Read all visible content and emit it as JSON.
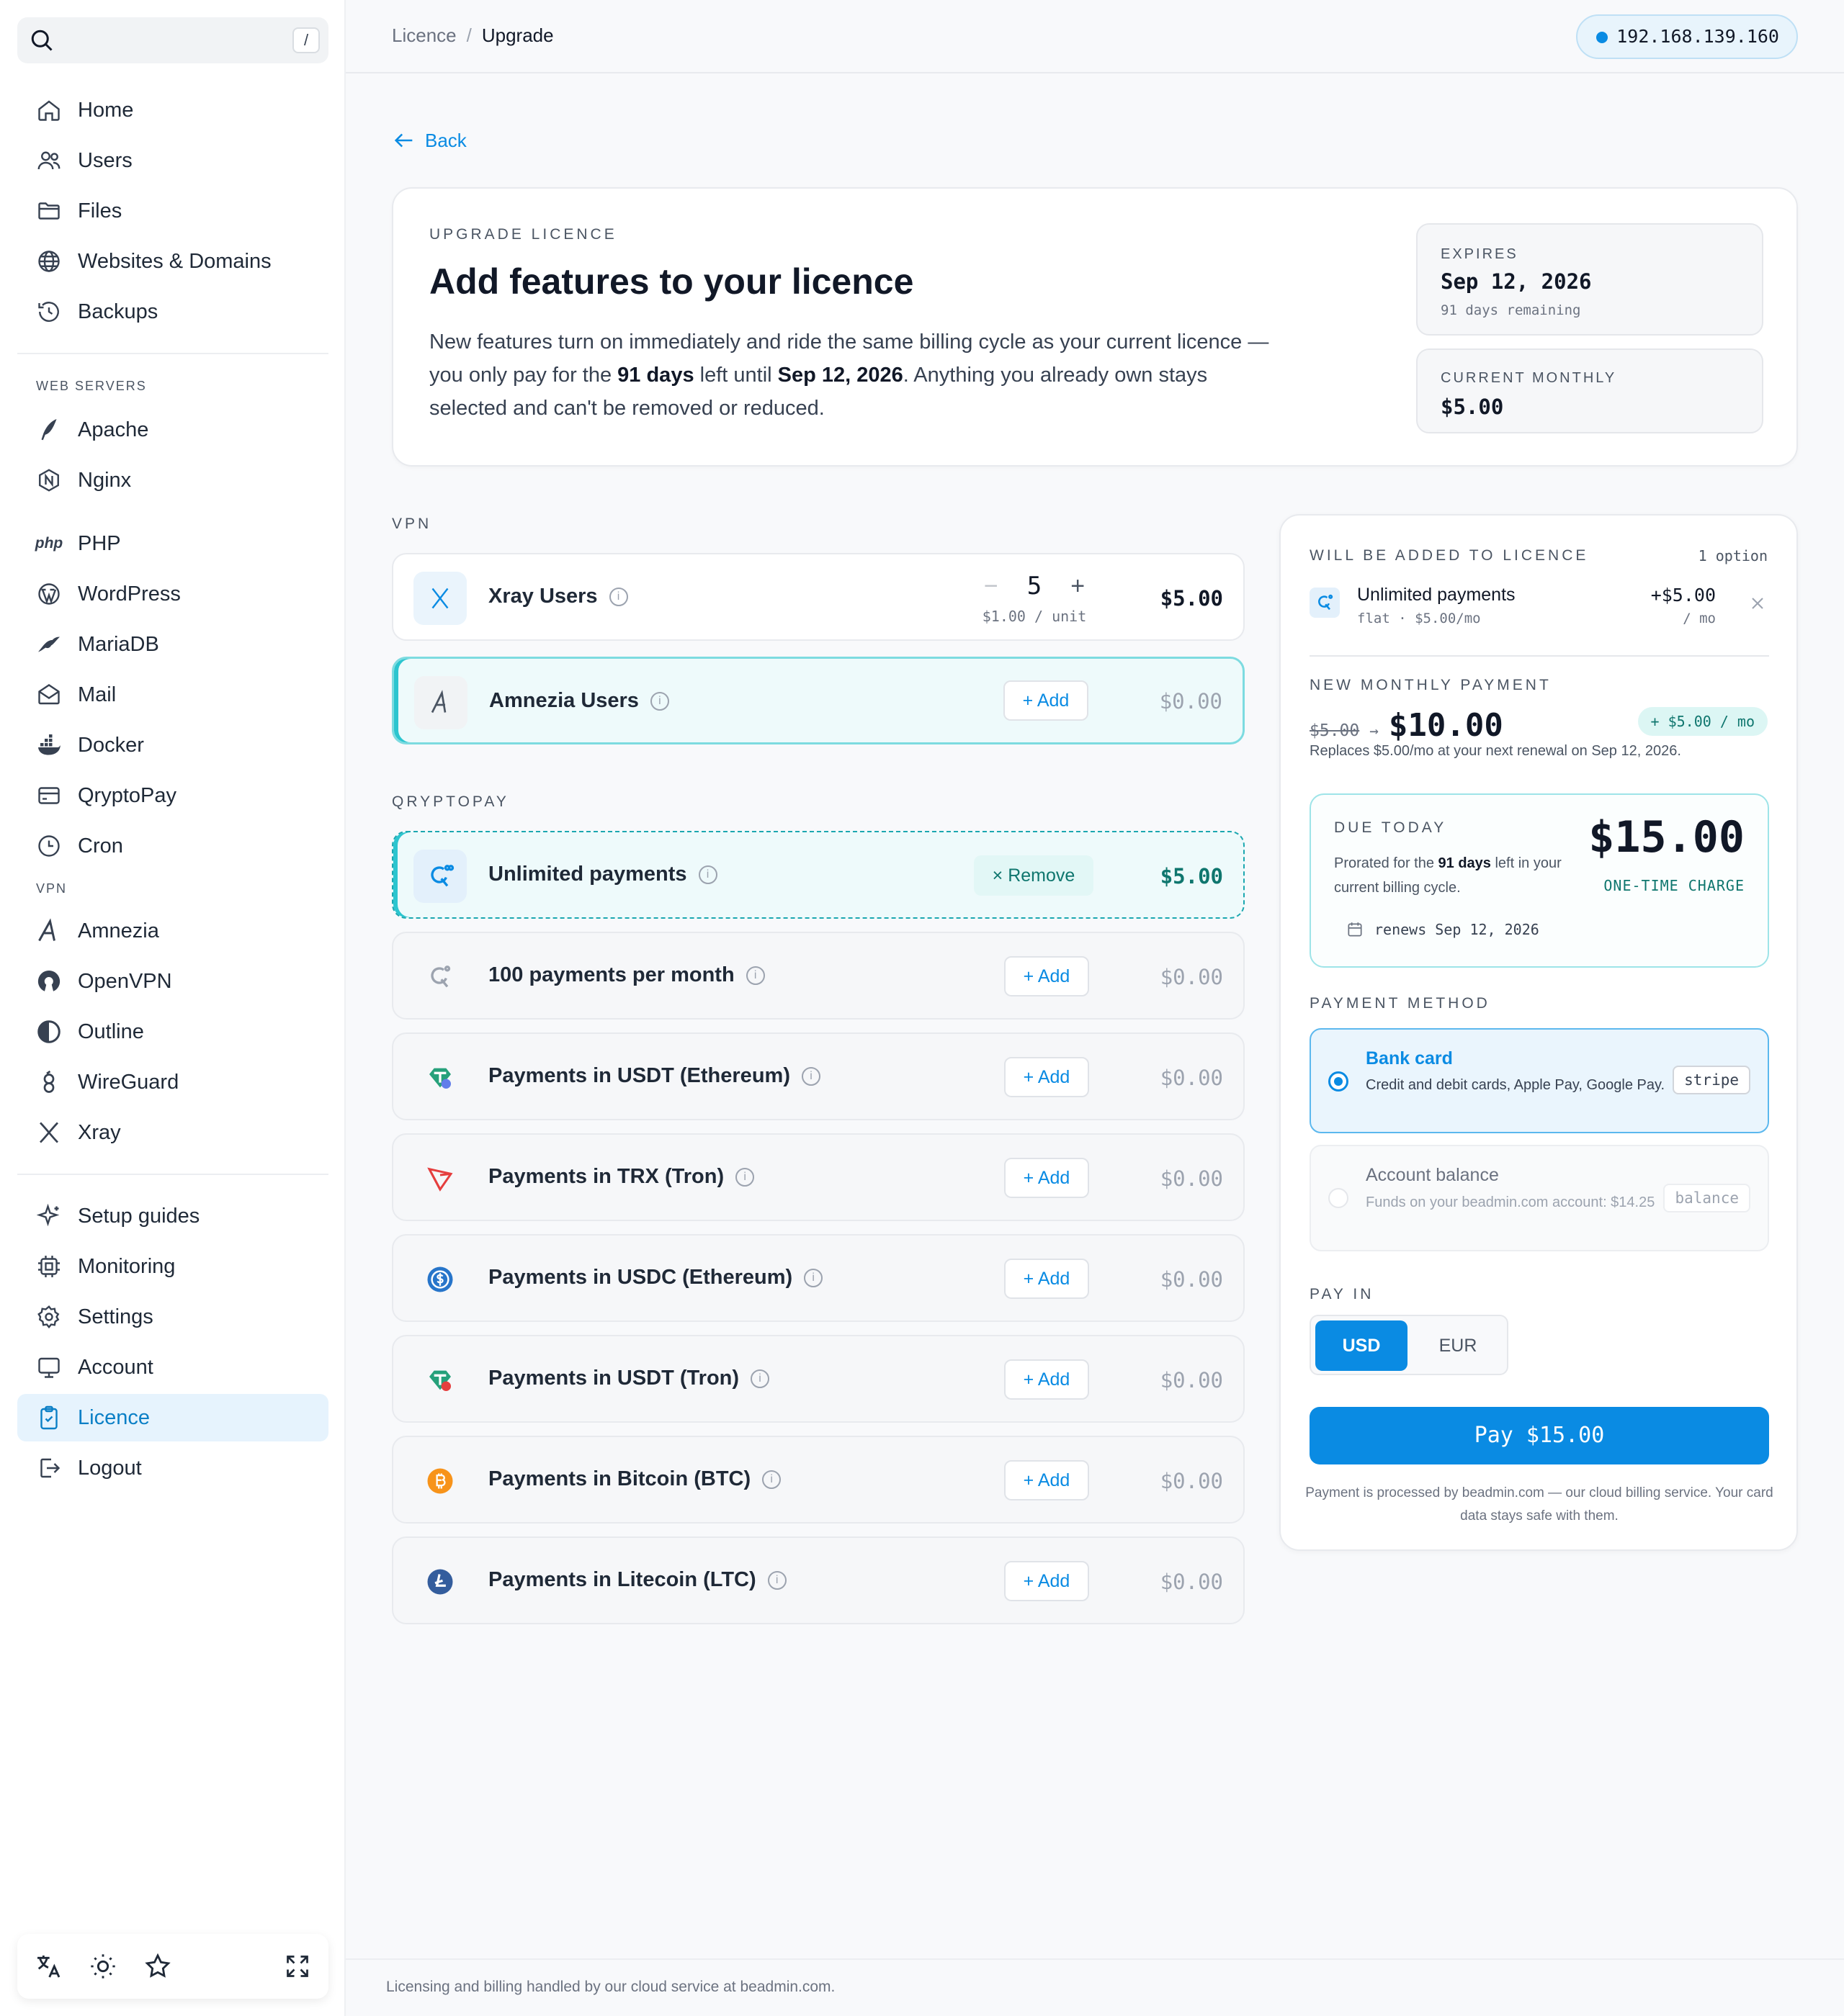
{
  "sidebar": {
    "search_shortcut": "/",
    "items_top": [
      {
        "label": "Home",
        "icon": "home-icon"
      },
      {
        "label": "Users",
        "icon": "users-icon"
      },
      {
        "label": "Files",
        "icon": "folder-icon"
      },
      {
        "label": "Websites & Domains",
        "icon": "globe-icon"
      },
      {
        "label": "Backups",
        "icon": "history-icon"
      }
    ],
    "group_web": "WEB SERVERS",
    "items_web": [
      {
        "label": "Apache",
        "icon": "feather-icon"
      },
      {
        "label": "Nginx",
        "icon": "nginx-icon"
      }
    ],
    "items_apps": [
      {
        "label": "PHP",
        "icon": "php-icon",
        "glyph": "php"
      },
      {
        "label": "WordPress",
        "icon": "wordpress-icon"
      },
      {
        "label": "MariaDB",
        "icon": "mariadb-icon"
      },
      {
        "label": "Mail",
        "icon": "mail-icon"
      },
      {
        "label": "Docker",
        "icon": "docker-icon"
      },
      {
        "label": "QryptoPay",
        "icon": "card-icon"
      },
      {
        "label": "Cron",
        "icon": "clock-icon"
      }
    ],
    "group_vpn": "VPN",
    "items_vpn": [
      {
        "label": "Amnezia",
        "icon": "amnezia-icon"
      },
      {
        "label": "OpenVPN",
        "icon": "openvpn-icon"
      },
      {
        "label": "Outline",
        "icon": "outline-icon"
      },
      {
        "label": "WireGuard",
        "icon": "wireguard-icon"
      },
      {
        "label": "Xray",
        "icon": "xray-icon"
      }
    ],
    "items_bottom": [
      {
        "label": "Setup guides",
        "icon": "sparkles-icon"
      },
      {
        "label": "Monitoring",
        "icon": "cpu-icon"
      },
      {
        "label": "Settings",
        "icon": "gear-icon"
      },
      {
        "label": "Account",
        "icon": "monitor-icon"
      },
      {
        "label": "Licence",
        "icon": "licence-icon",
        "active": true
      },
      {
        "label": "Logout",
        "icon": "logout-icon"
      }
    ]
  },
  "topbar": {
    "breadcrumb_parent": "Licence",
    "breadcrumb_sep": "/",
    "breadcrumb_current": "Upgrade",
    "ip": "192.168.139.160"
  },
  "back_label": "Back",
  "hero": {
    "eyebrow": "UPGRADE LICENCE",
    "title": "Add features to your licence",
    "desc_1": "New features turn on immediately and ride the same billing cycle as your current licence — you only pay for the ",
    "desc_days": "91 days",
    "desc_2": " left until ",
    "desc_date": "Sep 12, 2026",
    "desc_3": ". Anything you already own stays selected and can't be removed or reduced.",
    "expires_label": "EXPIRES",
    "expires_value": "Sep 12, 2026",
    "expires_sub": "91 days remaining",
    "monthly_label": "CURRENT MONTHLY",
    "monthly_value": "$5.00"
  },
  "sections": {
    "vpn": "VPN",
    "qryptopay": "QRYPTOPAY"
  },
  "vpn_items": {
    "xray": {
      "name": "Xray Users",
      "qty": "5",
      "minus": "−",
      "plus": "+",
      "unit": "$1.00 / unit",
      "price": "$5.00"
    },
    "amnezia": {
      "name": "Amnezia Users",
      "action": "+ Add",
      "price": "$0.00"
    }
  },
  "qrypto_items": [
    {
      "name": "Unlimited payments",
      "action": "× Remove",
      "price": "$5.00",
      "state": "selected",
      "icon": "qryptopay-icon"
    },
    {
      "name": "100 payments per month",
      "action": "+ Add",
      "price": "$0.00",
      "icon": "qryptopay-grey-icon"
    },
    {
      "name": "Payments in USDT (Ethereum)",
      "action": "+ Add",
      "price": "$0.00",
      "icon": "usdt-eth-icon"
    },
    {
      "name": "Payments in TRX (Tron)",
      "action": "+ Add",
      "price": "$0.00",
      "icon": "tron-icon"
    },
    {
      "name": "Payments in USDC (Ethereum)",
      "action": "+ Add",
      "price": "$0.00",
      "icon": "usdc-icon"
    },
    {
      "name": "Payments in USDT (Tron)",
      "action": "+ Add",
      "price": "$0.00",
      "icon": "usdt-tron-icon"
    },
    {
      "name": "Payments in Bitcoin (BTC)",
      "action": "+ Add",
      "price": "$0.00",
      "icon": "bitcoin-icon"
    },
    {
      "name": "Payments in Litecoin (LTC)",
      "action": "+ Add",
      "price": "$0.00",
      "icon": "litecoin-icon"
    }
  ],
  "info_glyph": "i",
  "summary": {
    "added_label": "WILL BE ADDED TO LICENCE",
    "added_count": "1 option",
    "item_name": "Unlimited payments",
    "item_sub": "flat · $5.00/mo",
    "item_price": "+$5.00",
    "item_per": "/ mo",
    "new_monthly_label": "NEW MONTHLY PAYMENT",
    "old_monthly": "$5.00",
    "arrow": "→",
    "new_monthly": "$10.00",
    "delta": "+ $5.00 / mo",
    "replaces": "Replaces $5.00/mo at your next renewal on Sep 12, 2026.",
    "due_label": "DUE TODAY",
    "due_desc_1": "Prorated for the ",
    "due_desc_days": "91 days",
    "due_desc_2": " left in your current billing cycle.",
    "due_amount": "$15.00",
    "due_charge": "ONE-TIME CHARGE",
    "renews": "renews Sep 12, 2026",
    "method_label": "PAYMENT METHOD",
    "bank_title": "Bank card",
    "bank_desc": "Credit and debit cards, Apple Pay, Google Pay.",
    "bank_tag": "stripe",
    "balance_title": "Account balance",
    "balance_desc": "Funds on your beadmin.com account: $14.25",
    "balance_tag": "balance",
    "pay_in_label": "PAY IN",
    "currency_on": "USD",
    "currency_off": "EUR",
    "pay_button": "Pay $15.00",
    "pay_note": "Payment is processed by beadmin.com — our cloud billing service. Your card data stays safe with them."
  },
  "footer": "Licensing and billing handled by our cloud service at beadmin.com.",
  "colors": {
    "accent": "#0a8be3",
    "teal": "#0f766e",
    "teal_border": "#7ddbe0"
  }
}
